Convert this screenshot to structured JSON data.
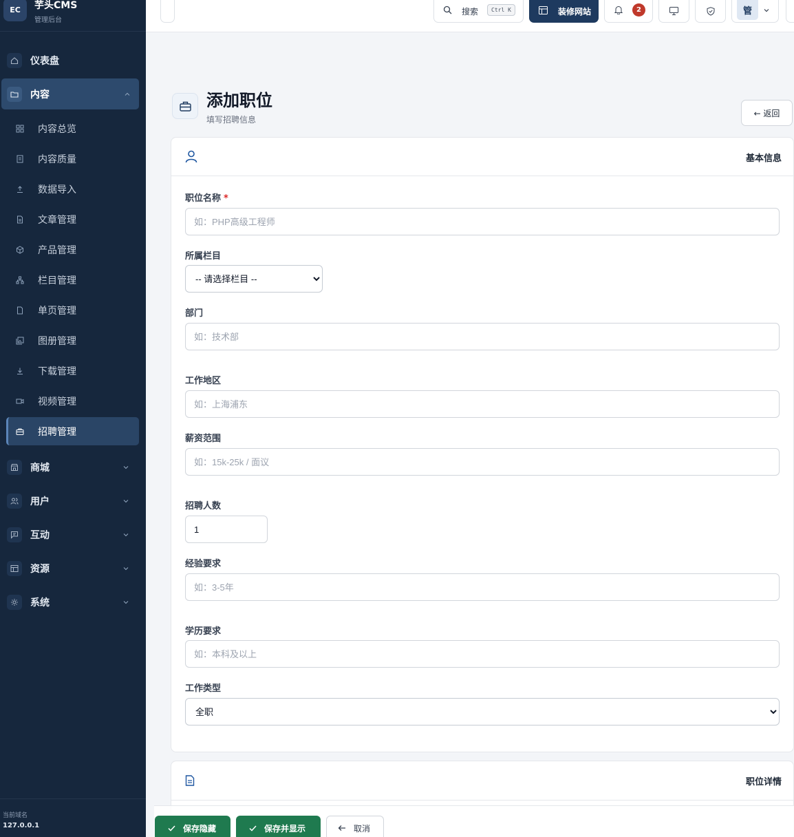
{
  "brand": {
    "logo": "EC",
    "name": "芋头CMS",
    "subtitle": "管理后台"
  },
  "sidebar": {
    "dashboard": "仪表盘",
    "content": "内容",
    "content_items": [
      "内容总览",
      "内容质量",
      "数据导入",
      "文章管理",
      "产品管理",
      "栏目管理",
      "单页管理",
      "图册管理",
      "下载管理",
      "视频管理",
      "招聘管理"
    ],
    "groups": [
      "商城",
      "用户",
      "互动",
      "资源",
      "系统"
    ],
    "footer_key": "当前域名",
    "footer_value": "127.0.0.1"
  },
  "topbar": {
    "search_label": "搜索",
    "search_shortcut": "Ctrl K",
    "decorate_label": "装修网站",
    "notification_count": "2",
    "avatar_text": "管"
  },
  "page": {
    "title": "添加职位",
    "subtitle": "填写招聘信息",
    "back_label": "← 返回"
  },
  "section_basic": {
    "title": "基本信息"
  },
  "form": {
    "title": {
      "label": "职位名称",
      "required_mark": "*",
      "placeholder": "如：PHP高级工程师",
      "value": ""
    },
    "category": {
      "label": "所属栏目",
      "selected": "-- 请选择栏目 --"
    },
    "department": {
      "label": "部门",
      "placeholder": "如：技术部",
      "value": ""
    },
    "location": {
      "label": "工作地区",
      "placeholder": "如：上海浦东",
      "value": ""
    },
    "salary": {
      "label": "薪资范围",
      "placeholder": "如：15k-25k / 面议",
      "value": ""
    },
    "headcount": {
      "label": "招聘人数",
      "value": "1"
    },
    "experience": {
      "label": "经验要求",
      "placeholder": "如：3-5年",
      "value": ""
    },
    "education": {
      "label": "学历要求",
      "placeholder": "如：本科及以上",
      "value": ""
    },
    "job_type": {
      "label": "工作类型",
      "selected": "全职"
    }
  },
  "section_detail": {
    "title": "职位详情"
  },
  "actions": {
    "save_hidden": "保存隐藏",
    "save_show": "保存并显示",
    "cancel": "取消"
  },
  "colors": {
    "sidebar_bg": "#16273d",
    "accent": "#1e3a5f",
    "success": "#1f7a4f",
    "badge": "#c0392b"
  }
}
